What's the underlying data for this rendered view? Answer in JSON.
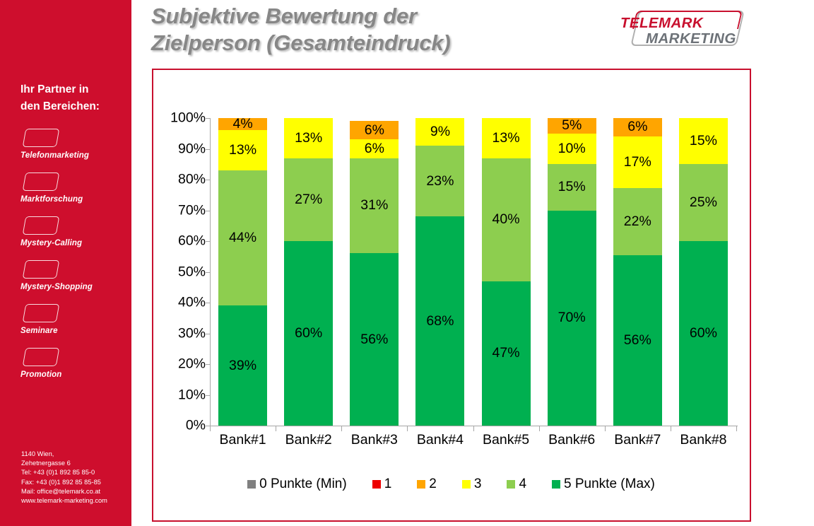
{
  "sidebar": {
    "heading": "Ihr Partner in den Bereichen:",
    "heading_line1": "Ihr Partner in",
    "heading_line2": "den Bereichen:",
    "services": [
      {
        "label": "Telefonmarketing"
      },
      {
        "label": "Marktforschung"
      },
      {
        "label": "Mystery-Calling"
      },
      {
        "label": "Mystery-Shopping"
      },
      {
        "label": "Seminare"
      },
      {
        "label": "Promotion"
      }
    ],
    "contact": {
      "line1": "1140 Wien,",
      "line2": "Zehetnergasse 6",
      "line3": "Tel: +43 (0)1 892 85 85-0",
      "line4": "Fax: +43 (0)1 892 85 85-85",
      "line5": "Mail: office@telemark.co.at",
      "line6": "www.telemark-marketing.com"
    },
    "background_color": "#ce0e2d"
  },
  "header": {
    "title_line1": "Subjektive Bewertung der",
    "title_line2": "Zielperson (Gesamteindruck)",
    "title_color": "#878787"
  },
  "logo": {
    "top_word": "TELEMARK",
    "bottom_word": "MARKETING",
    "top_color": "#c8102e",
    "bottom_color": "#6d7278"
  },
  "chart_data": {
    "type": "bar",
    "stacked": true,
    "title": "Subjektive Bewertung der Zielperson (Gesamteindruck)",
    "xlabel": "",
    "ylabel": "",
    "ylim": [
      0,
      100
    ],
    "yticks": [
      "0%",
      "10%",
      "20%",
      "30%",
      "40%",
      "50%",
      "60%",
      "70%",
      "80%",
      "90%",
      "100%"
    ],
    "grid": false,
    "legend_position": "bottom",
    "categories": [
      "Bank#1",
      "Bank#2",
      "Bank#3",
      "Bank#4",
      "Bank#5",
      "Bank#6",
      "Bank#7",
      "Bank#8"
    ],
    "series": [
      {
        "name": "0 Punkte (Min)",
        "color": "#808080",
        "values": [
          0,
          0,
          0,
          0,
          0,
          0,
          0,
          0
        ],
        "labels": [
          "",
          "",
          "",
          "",
          "",
          "",
          "",
          ""
        ]
      },
      {
        "name": "1",
        "color": "#ee0000",
        "values": [
          0,
          0,
          0,
          0,
          0,
          0,
          0,
          0
        ],
        "labels": [
          "",
          "",
          "",
          "",
          "",
          "",
          "",
          ""
        ]
      },
      {
        "name": "2",
        "color": "#ffa500",
        "values": [
          4,
          0,
          6,
          0,
          0,
          5,
          6,
          0
        ],
        "labels": [
          "4%",
          "",
          "6%",
          "",
          "",
          "5%",
          "6%",
          ""
        ]
      },
      {
        "name": "3",
        "color": "#ffff00",
        "values": [
          13,
          13,
          6,
          9,
          13,
          10,
          17,
          15
        ],
        "labels": [
          "13%",
          "13%",
          "6%",
          "9%",
          "13%",
          "10%",
          "17%",
          "15%"
        ]
      },
      {
        "name": "4",
        "color": "#8dce4f",
        "values": [
          44,
          27,
          31,
          23,
          40,
          15,
          22,
          25
        ],
        "labels": [
          "44%",
          "27%",
          "31%",
          "23%",
          "40%",
          "15%",
          "22%",
          "25%"
        ]
      },
      {
        "name": "5 Punkte (Max)",
        "color": "#00b050",
        "values": [
          39,
          60,
          56,
          68,
          47,
          70,
          56,
          60
        ],
        "labels": [
          "39%",
          "60%",
          "56%",
          "68%",
          "47%",
          "70%",
          "56%",
          "60%"
        ]
      }
    ]
  },
  "frame": {
    "border_color": "#c8102e"
  }
}
